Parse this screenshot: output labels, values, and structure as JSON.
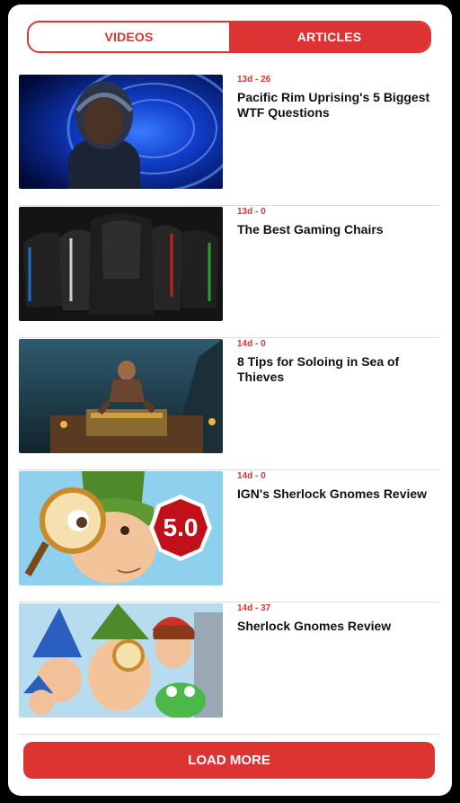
{
  "tabs": {
    "videos": "VIDEOS",
    "articles": "ARTICLES",
    "active": "articles"
  },
  "articles": [
    {
      "meta": "13d - 26",
      "title": "Pacific Rim Uprising's 5 Biggest WTF Questions"
    },
    {
      "meta": "13d - 0",
      "title": "The Best Gaming Chairs"
    },
    {
      "meta": "14d - 0",
      "title": "8 Tips for Soloing in Sea of Thieves"
    },
    {
      "meta": "14d - 0",
      "title": "IGN's Sherlock Gnomes Review",
      "thumb_badge": "5.0"
    },
    {
      "meta": "14d - 37",
      "title": "Sherlock Gnomes Review"
    }
  ],
  "load_more": "LOAD MORE",
  "colors": {
    "accent": "#dd3333",
    "background": "#000000",
    "card": "#ffffff"
  }
}
